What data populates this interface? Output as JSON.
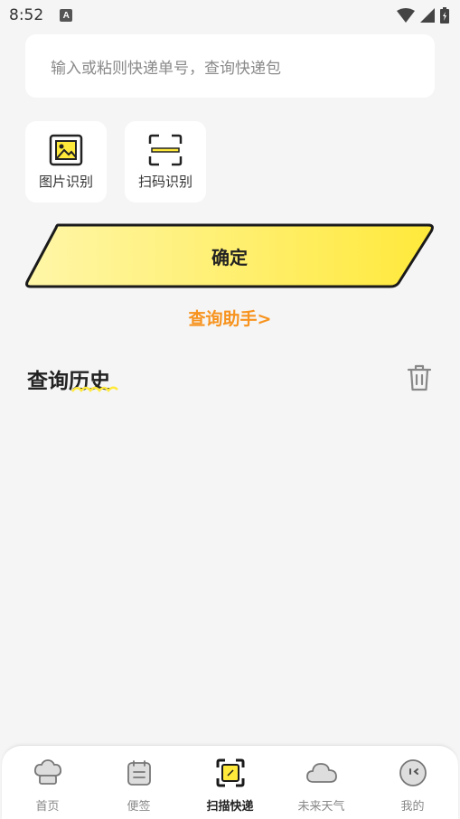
{
  "status": {
    "time": "8:52",
    "notif_letter": "A"
  },
  "search": {
    "placeholder": "输入或粘则快递单号，查询快递包"
  },
  "tools": [
    {
      "label": "图片识别",
      "icon": "image-scan-icon"
    },
    {
      "label": "扫码识别",
      "icon": "barcode-scan-icon"
    }
  ],
  "confirm": {
    "label": "确定"
  },
  "helper": {
    "label": "查询助手>"
  },
  "history": {
    "title": "查询历史"
  },
  "nav": [
    {
      "label": "首页",
      "icon": "chef-hat-icon",
      "active": false
    },
    {
      "label": "便签",
      "icon": "notepad-icon",
      "active": false
    },
    {
      "label": "扫描快递",
      "icon": "scan-frame-icon",
      "active": true
    },
    {
      "label": "未来天气",
      "icon": "cloud-icon",
      "active": false
    },
    {
      "label": "我的",
      "icon": "face-icon",
      "active": false
    }
  ],
  "colors": {
    "accent": "#ffe93b",
    "helper": "#f7931e",
    "background": "#f5f5f5"
  }
}
